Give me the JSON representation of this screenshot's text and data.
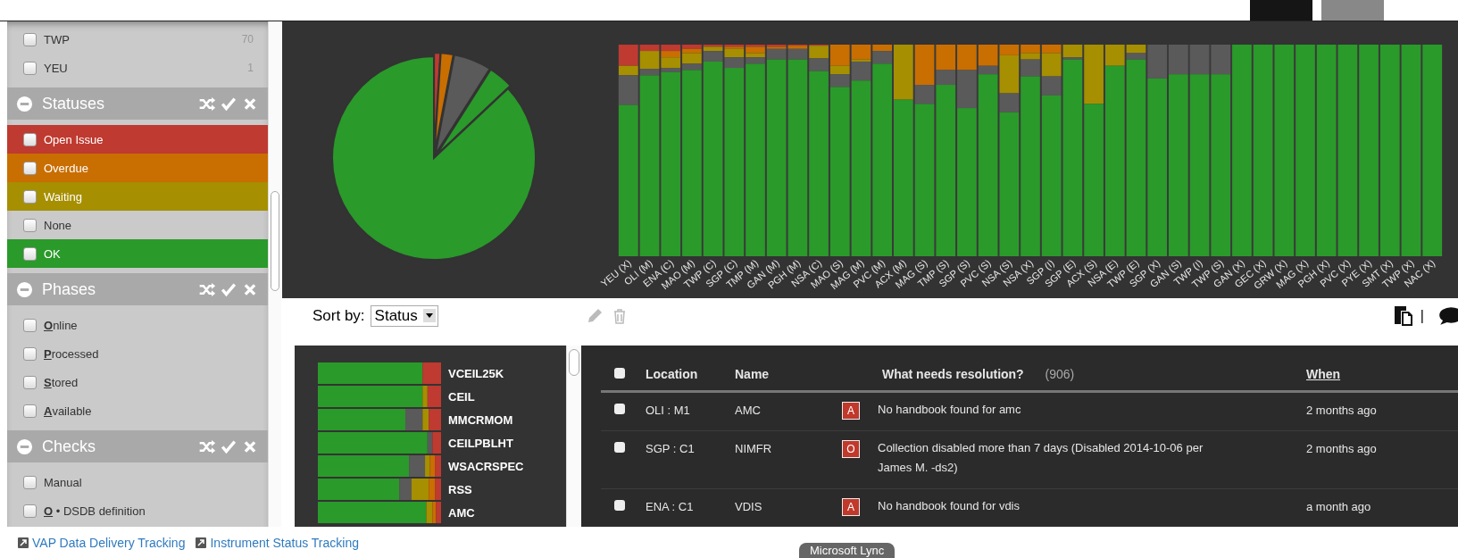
{
  "sidebar": {
    "top_items": [
      {
        "label": "TWP",
        "count": "70",
        "checked": false
      },
      {
        "label": "YEU",
        "count": "1",
        "checked": false
      }
    ],
    "groups": [
      {
        "title": "Statuses",
        "items": [
          {
            "label": "Open Issue",
            "kind": "colored",
            "color": "#bf3a30",
            "checked": false
          },
          {
            "label": "Overdue",
            "kind": "colored",
            "color": "#c96e00",
            "checked": false
          },
          {
            "label": "Waiting",
            "kind": "colored",
            "color": "#a68f00",
            "checked": false
          },
          {
            "label": "None",
            "kind": "plain",
            "checked": false
          },
          {
            "label": "OK",
            "kind": "colored",
            "color": "#2a9a2a",
            "checked": false
          }
        ]
      },
      {
        "title": "Phases",
        "items": [
          {
            "label": "Online",
            "kind": "hotkey",
            "checked": false
          },
          {
            "label": "Processed",
            "kind": "hotkey",
            "checked": false
          },
          {
            "label": "Stored",
            "kind": "hotkey",
            "checked": false
          },
          {
            "label": "Available",
            "kind": "hotkey",
            "checked": false
          }
        ]
      },
      {
        "title": "Checks",
        "items": [
          {
            "label": "Manual",
            "kind": "plain",
            "checked": false
          },
          {
            "label": "O • DSDB definition",
            "kind": "hotkey",
            "checked": false
          }
        ]
      }
    ]
  },
  "overview": {
    "bar_labels": [
      "YEU (X)",
      "OLI (M)",
      "ENA (C)",
      "MAO (M)",
      "TWP (C)",
      "SGP (C)",
      "TMP (M)",
      "GAN (M)",
      "PGH (M)",
      "NSA (C)",
      "MAO (S)",
      "MAG (M)",
      "PVC (M)",
      "ACX (M)",
      "MAG (S)",
      "TMP (S)",
      "SGP (S)",
      "PVC (S)",
      "NSA (S)",
      "NSA (X)",
      "SGP (I)",
      "SGP (E)",
      "ACX (S)",
      "NSA (E)",
      "TWP (E)",
      "SGP (X)",
      "GAN (S)",
      "TWP (I)",
      "TWP (S)",
      "GAN (X)",
      "GEC (X)",
      "GRW (X)",
      "MAG (X)",
      "PGH (X)",
      "PVC (X)",
      "PYE (X)",
      "SMT (X)",
      "TWP (X)",
      "NAC (X)"
    ]
  },
  "sort": {
    "label": "Sort by:",
    "value": "Status"
  },
  "toolbar_separator": "|",
  "instruments": {
    "labels": [
      "VCEIL25K",
      "CEIL",
      "MMCRMOM",
      "CEILPBLHT",
      "WSACRSPEC",
      "RSS",
      "AMC"
    ]
  },
  "table": {
    "header_checked": false,
    "columns": [
      {
        "label": "Location",
        "sorted": false
      },
      {
        "label": "Name",
        "sorted": false
      },
      {
        "label": "What needs resolution?",
        "count": "(906)",
        "sorted": false
      },
      {
        "label": "When",
        "sorted": true
      }
    ],
    "rows": [
      {
        "checked": false,
        "location": "OLI : M1",
        "name": "AMC",
        "badge": "A",
        "issue": "No handbook found for amc",
        "when": "2 months ago"
      },
      {
        "checked": false,
        "location": "SGP : C1",
        "name": "NIMFR",
        "badge": "O",
        "issue": "Collection disabled more than 7 days (Disabled 2014-10-06 per James M. -ds2)",
        "when": "2 months ago"
      },
      {
        "checked": false,
        "location": "ENA : C1",
        "name": "VDIS",
        "badge": "A",
        "issue": "No handbook found for vdis",
        "when": "a month ago"
      }
    ]
  },
  "footer": {
    "links": [
      "VAP Data Delivery Tracking",
      "Instrument Status Tracking"
    ],
    "taskbar_label": "Microsoft Lync"
  }
}
